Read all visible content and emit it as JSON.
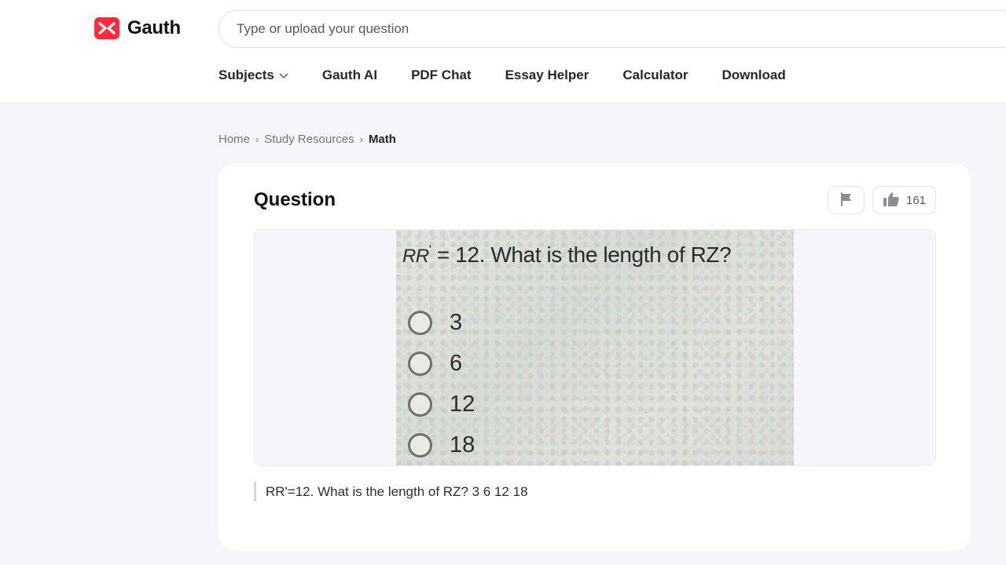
{
  "brand": {
    "name": "Gauth",
    "color": "#ff2b3a"
  },
  "search": {
    "placeholder": "Type or upload your question"
  },
  "nav": {
    "items": [
      {
        "label": "Subjects",
        "has_dropdown": true
      },
      {
        "label": "Gauth AI"
      },
      {
        "label": "PDF Chat"
      },
      {
        "label": "Essay Helper"
      },
      {
        "label": "Calculator"
      },
      {
        "label": "Download"
      }
    ]
  },
  "breadcrumb": {
    "items": [
      "Home",
      "Study Resources"
    ],
    "current": "Math"
  },
  "question": {
    "heading": "Question",
    "like_count": "161",
    "image": {
      "prefix": "RR",
      "prime": "'",
      "prompt": " = 12. What is the length of RZ?",
      "options": [
        "3",
        "6",
        "12",
        "18"
      ]
    },
    "text": "RR'=12. What is the length of RZ? 3 6 12 18"
  },
  "icons": {
    "logo": "gauth-logo-icon",
    "chevron": "chevron-down-icon",
    "flag": "flag-icon",
    "like": "thumbs-up-icon"
  },
  "colors": {
    "page_bg": "#f5f6fa",
    "card_bg": "#ffffff",
    "accent": "#ff2b3a"
  }
}
